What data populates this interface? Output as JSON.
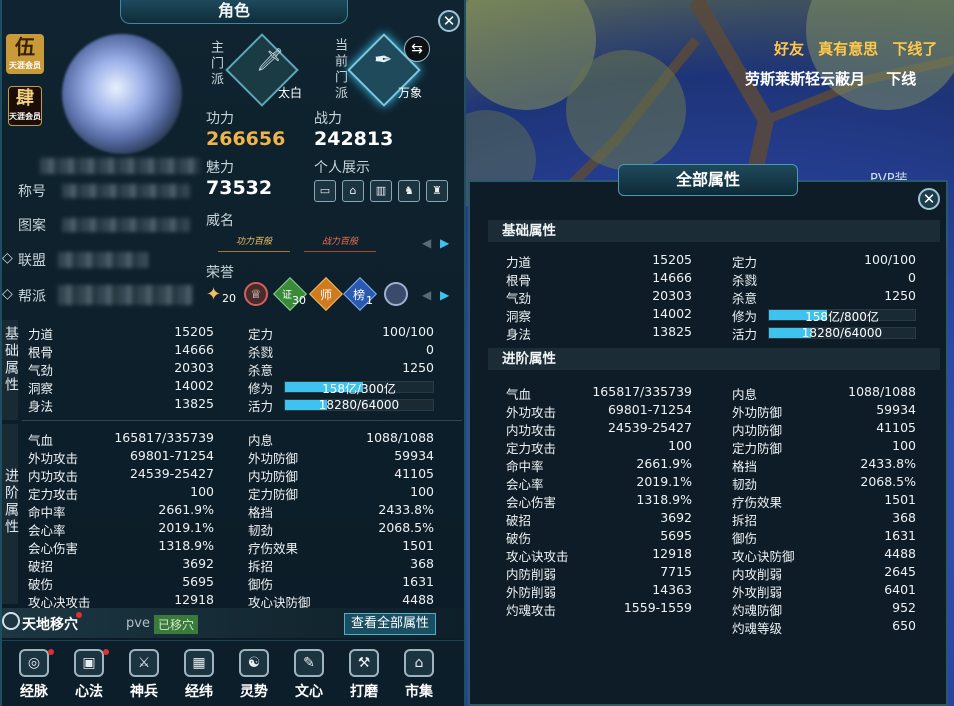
{
  "left": {
    "title": "角色",
    "badges": [
      "伍",
      "肆"
    ],
    "badge_subs": [
      "天涯会员",
      "天涯会员"
    ],
    "labels": {
      "title": "称号",
      "pattern": "图案",
      "alliance": "联盟",
      "guild": "帮派"
    },
    "school": {
      "main_label": "主门派",
      "main_name": "太白",
      "current_label": "当前门派",
      "current_name": "万象"
    },
    "gongli": {
      "label": "功力",
      "value": "266656"
    },
    "zhanli": {
      "label": "战力",
      "value": "242813"
    },
    "meili": {
      "label": "魅力",
      "value": "73532"
    },
    "showcase_label": "个人展示",
    "fame_label": "威名",
    "honor_label": "荣誉",
    "honor_counts": [
      "20",
      "30",
      "1"
    ],
    "honor_glyphs": [
      "师",
      "榜",
      "证"
    ],
    "fame_items": [
      "功力百般",
      "战力百般"
    ],
    "side_basic": "基础属性",
    "side_adv": "进阶属性",
    "basic_left": [
      {
        "k": "力道",
        "v": "15205"
      },
      {
        "k": "根骨",
        "v": "14666"
      },
      {
        "k": "气劲",
        "v": "20303"
      },
      {
        "k": "洞察",
        "v": "14002"
      },
      {
        "k": "身法",
        "v": "13825"
      }
    ],
    "basic_right": [
      {
        "k": "定力",
        "v": "100/100"
      },
      {
        "k": "杀戮",
        "v": "0"
      },
      {
        "k": "杀意",
        "v": "1250"
      }
    ],
    "xiuwei": {
      "k": "修为",
      "text": "158亿/300亿",
      "fraction": 0.527
    },
    "huoli": {
      "k": "活力",
      "text": "18280/64000",
      "fraction": 0.286
    },
    "adv_left": [
      {
        "k": "气血",
        "v": "165817/335739"
      },
      {
        "k": "外功攻击",
        "v": "69801-71254"
      },
      {
        "k": "内功攻击",
        "v": "24539-25427"
      },
      {
        "k": "定力攻击",
        "v": "100"
      },
      {
        "k": "命中率",
        "v": "2661.9%"
      },
      {
        "k": "会心率",
        "v": "2019.1%"
      },
      {
        "k": "会心伤害",
        "v": "1318.9%"
      },
      {
        "k": "破招",
        "v": "3692"
      },
      {
        "k": "破伤",
        "v": "5695"
      },
      {
        "k": "攻心决攻击",
        "v": "12918"
      }
    ],
    "adv_right": [
      {
        "k": "内息",
        "v": "1088/1088"
      },
      {
        "k": "外功防御",
        "v": "59934"
      },
      {
        "k": "内功防御",
        "v": "41105"
      },
      {
        "k": "定力防御",
        "v": "100"
      },
      {
        "k": "格挡",
        "v": "2433.8%"
      },
      {
        "k": "韧劲",
        "v": "2068.5%"
      },
      {
        "k": "疗伤效果",
        "v": "1501"
      },
      {
        "k": "拆招",
        "v": "368"
      },
      {
        "k": "御伤",
        "v": "1631"
      },
      {
        "k": "攻心诀防御",
        "v": "4488"
      }
    ],
    "tiandi": {
      "label": "天地移穴",
      "mode": "pve",
      "status": "已移穴",
      "view_all": "查看全部属性"
    },
    "menu": [
      {
        "name": "经脉",
        "glyph": "◎"
      },
      {
        "name": "心法",
        "glyph": "▣"
      },
      {
        "name": "神兵",
        "glyph": "⚔"
      },
      {
        "name": "经纬",
        "glyph": "▦"
      },
      {
        "name": "灵势",
        "glyph": "☯"
      },
      {
        "name": "文心",
        "glyph": "✎"
      },
      {
        "name": "打磨",
        "glyph": "⚒"
      },
      {
        "name": "市集",
        "glyph": "⌂"
      }
    ]
  },
  "chat": {
    "line1": [
      "好友",
      "真有意思",
      "下线了"
    ],
    "line2": "劳斯莱斯轻云蔽月",
    "line2b": "下线",
    "behind": "PVP装"
  },
  "right": {
    "title": "全部属性",
    "basic_head": "基础属性",
    "adv_head": "进阶属性",
    "basic_left": [
      {
        "k": "力道",
        "v": "15205"
      },
      {
        "k": "根骨",
        "v": "14666"
      },
      {
        "k": "气劲",
        "v": "20303"
      },
      {
        "k": "洞察",
        "v": "14002"
      },
      {
        "k": "身法",
        "v": "13825"
      }
    ],
    "basic_right": [
      {
        "k": "定力",
        "v": "100/100"
      },
      {
        "k": "杀戮",
        "v": "0"
      },
      {
        "k": "杀意",
        "v": "1250"
      }
    ],
    "xiuwei": {
      "k": "修为",
      "text": "158亿/800亿",
      "fraction": 0.395
    },
    "huoli": {
      "k": "活力",
      "text": "18280/64000",
      "fraction": 0.286
    },
    "adv_left": [
      {
        "k": "气血",
        "v": "165817/335739"
      },
      {
        "k": "外功攻击",
        "v": "69801-71254"
      },
      {
        "k": "内功攻击",
        "v": "24539-25427"
      },
      {
        "k": "定力攻击",
        "v": "100"
      },
      {
        "k": "命中率",
        "v": "2661.9%"
      },
      {
        "k": "会心率",
        "v": "2019.1%"
      },
      {
        "k": "会心伤害",
        "v": "1318.9%"
      },
      {
        "k": "破招",
        "v": "3692"
      },
      {
        "k": "破伤",
        "v": "5695"
      },
      {
        "k": "攻心诀攻击",
        "v": "12918"
      },
      {
        "k": "内防削弱",
        "v": "7715"
      },
      {
        "k": "外防削弱",
        "v": "14363"
      },
      {
        "k": "灼魂攻击",
        "v": "1559-1559"
      }
    ],
    "adv_right": [
      {
        "k": "内息",
        "v": "1088/1088"
      },
      {
        "k": "外功防御",
        "v": "59934"
      },
      {
        "k": "内功防御",
        "v": "41105"
      },
      {
        "k": "定力防御",
        "v": "100"
      },
      {
        "k": "格挡",
        "v": "2433.8%"
      },
      {
        "k": "韧劲",
        "v": "2068.5%"
      },
      {
        "k": "疗伤效果",
        "v": "1501"
      },
      {
        "k": "拆招",
        "v": "368"
      },
      {
        "k": "御伤",
        "v": "1631"
      },
      {
        "k": "攻心诀防御",
        "v": "4488"
      },
      {
        "k": "内攻削弱",
        "v": "2645"
      },
      {
        "k": "外攻削弱",
        "v": "6401"
      },
      {
        "k": "灼魂防御",
        "v": "952"
      },
      {
        "k": "灼魂等级",
        "v": "650"
      }
    ]
  },
  "colors": {
    "accent": "#3ec3ef",
    "gold": "#f0b44a",
    "chat": "#ffc84a",
    "badge_green": "#3a8a3a"
  }
}
